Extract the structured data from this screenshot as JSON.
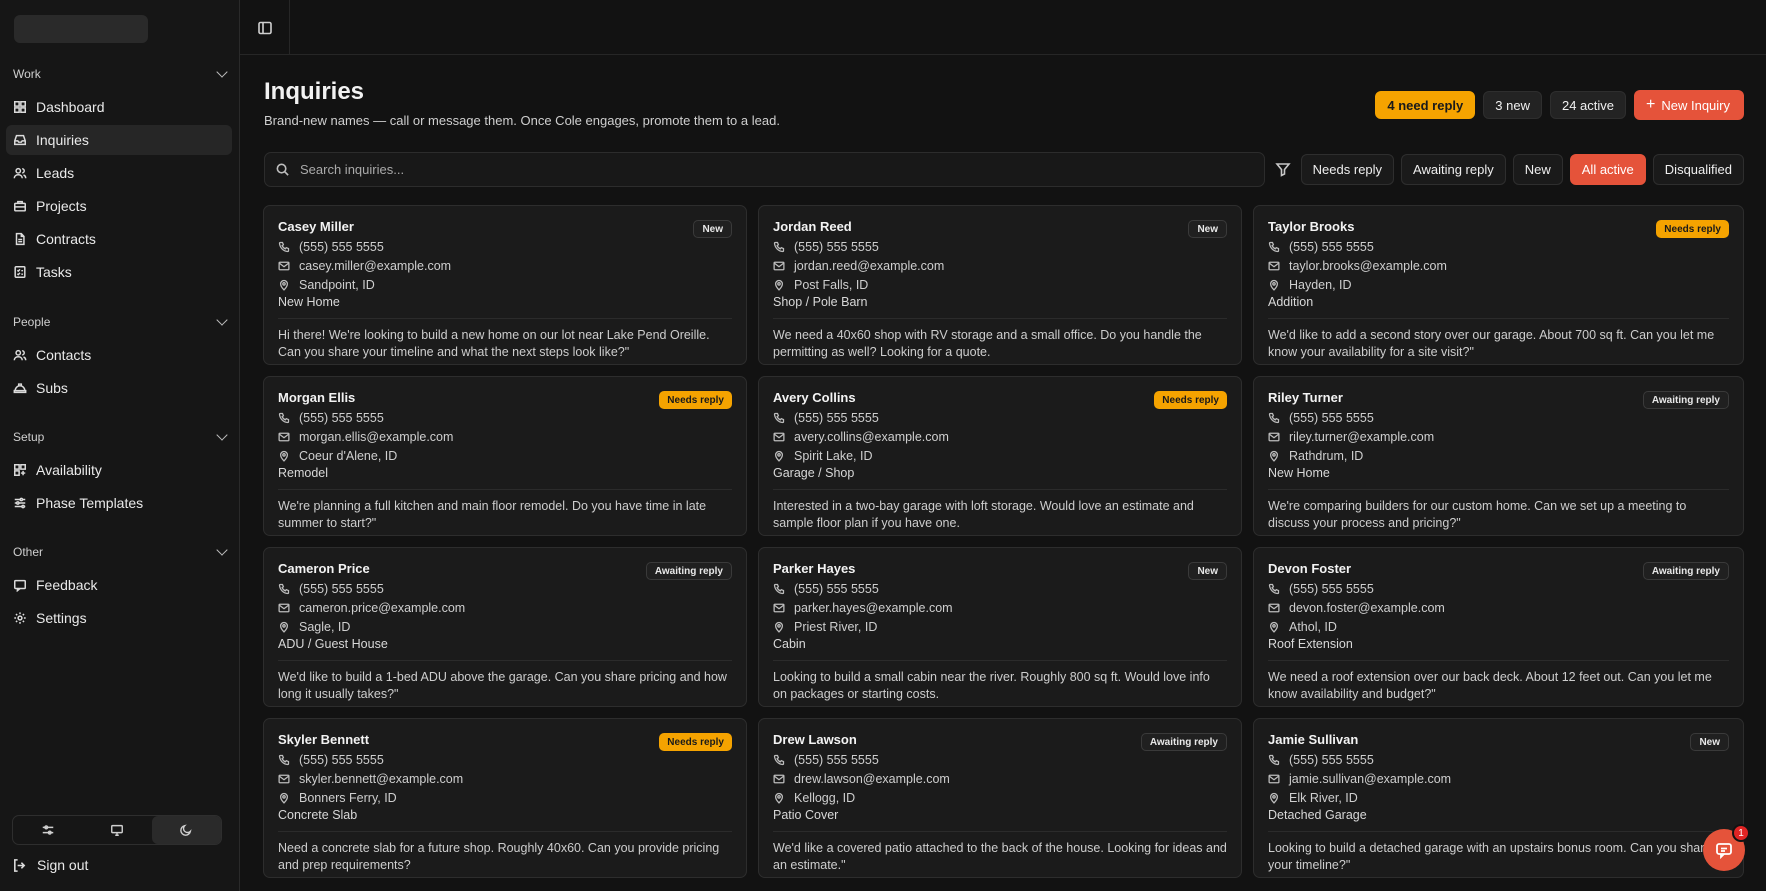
{
  "sidebar": {
    "groups": [
      {
        "label": "Work",
        "items": [
          {
            "label": "Dashboard",
            "icon": "dashboard-icon"
          },
          {
            "label": "Inquiries",
            "icon": "inbox-icon",
            "active": true
          },
          {
            "label": "Leads",
            "icon": "users-icon"
          },
          {
            "label": "Projects",
            "icon": "briefcase-icon"
          },
          {
            "label": "Contracts",
            "icon": "file-icon"
          },
          {
            "label": "Tasks",
            "icon": "checklist-icon"
          }
        ]
      },
      {
        "label": "People",
        "items": [
          {
            "label": "Contacts",
            "icon": "users-icon"
          },
          {
            "label": "Subs",
            "icon": "hardhat-icon"
          }
        ]
      },
      {
        "label": "Setup",
        "items": [
          {
            "label": "Availability",
            "icon": "calendar-icon"
          },
          {
            "label": "Phase Templates",
            "icon": "layers-icon"
          }
        ]
      },
      {
        "label": "Other",
        "items": [
          {
            "label": "Feedback",
            "icon": "message-icon"
          },
          {
            "label": "Settings",
            "icon": "gear-icon"
          }
        ]
      }
    ],
    "sign_out": "Sign out"
  },
  "header": {
    "title": "Inquiries",
    "subtitle": "Brand-new names — call or message them. Once Cole engages, promote them to a lead.",
    "stats": {
      "need_reply": "4 need reply",
      "new": "3 new",
      "active": "24 active"
    },
    "new_button": "New Inquiry"
  },
  "search": {
    "placeholder": "Search inquiries..."
  },
  "filters": [
    {
      "label": "Needs reply",
      "active": false
    },
    {
      "label": "Awaiting reply",
      "active": false
    },
    {
      "label": "New",
      "active": false
    },
    {
      "label": "All active",
      "active": true
    },
    {
      "label": "Disqualified",
      "active": false
    }
  ],
  "inquiries": [
    {
      "name": "Casey Miller",
      "status": "New",
      "status_type": "new",
      "phone": "(555) 555 5555",
      "email": "casey.miller@example.com",
      "location": "Sandpoint, ID",
      "project": "New Home",
      "message": "Hi there! We're looking to build a new home on our lot near Lake Pend Oreille. Can you share your timeline and what the next steps look like?\""
    },
    {
      "name": "Jordan Reed",
      "status": "New",
      "status_type": "new",
      "phone": "(555) 555 5555",
      "email": "jordan.reed@example.com",
      "location": "Post Falls, ID",
      "project": "Shop / Pole Barn",
      "message": "We need a 40x60 shop with RV storage and a small office. Do you handle the permitting as well? Looking for a quote."
    },
    {
      "name": "Taylor Brooks",
      "status": "Needs reply",
      "status_type": "needs",
      "phone": "(555) 555 5555",
      "email": "taylor.brooks@example.com",
      "location": "Hayden, ID",
      "project": "Addition",
      "message": "We'd like to add a second story over our garage. About 700 sq ft. Can you let me know your availability for a site visit?\""
    },
    {
      "name": "Morgan Ellis",
      "status": "Needs reply",
      "status_type": "needs",
      "phone": "(555) 555 5555",
      "email": "morgan.ellis@example.com",
      "location": "Coeur d'Alene, ID",
      "project": "Remodel",
      "message": "We're planning a full kitchen and main floor remodel. Do you have time in late summer to start?\""
    },
    {
      "name": "Avery Collins",
      "status": "Needs reply",
      "status_type": "needs",
      "phone": "(555) 555 5555",
      "email": "avery.collins@example.com",
      "location": "Spirit Lake, ID",
      "project": "Garage / Shop",
      "message": "Interested in a two-bay garage with loft storage. Would love an estimate and sample floor plan if you have one."
    },
    {
      "name": "Riley Turner",
      "status": "Awaiting reply",
      "status_type": "awaiting",
      "phone": "(555) 555 5555",
      "email": "riley.turner@example.com",
      "location": "Rathdrum, ID",
      "project": "New Home",
      "message": "We're comparing builders for our custom home. Can we set up a meeting to discuss your process and pricing?\""
    },
    {
      "name": "Cameron Price",
      "status": "Awaiting reply",
      "status_type": "awaiting",
      "phone": "(555) 555 5555",
      "email": "cameron.price@example.com",
      "location": "Sagle, ID",
      "project": "ADU / Guest House",
      "message": "We'd like to build a 1-bed ADU above the garage. Can you share pricing and how long it usually takes?\""
    },
    {
      "name": "Parker Hayes",
      "status": "New",
      "status_type": "new",
      "phone": "(555) 555 5555",
      "email": "parker.hayes@example.com",
      "location": "Priest River, ID",
      "project": "Cabin",
      "message": "Looking to build a small cabin near the river. Roughly 800 sq ft. Would love info on packages or starting costs."
    },
    {
      "name": "Devon Foster",
      "status": "Awaiting reply",
      "status_type": "awaiting",
      "phone": "(555) 555 5555",
      "email": "devon.foster@example.com",
      "location": "Athol, ID",
      "project": "Roof Extension",
      "message": "We need a roof extension over our back deck. About 12 feet out. Can you let me know availability and budget?\""
    },
    {
      "name": "Skyler Bennett",
      "status": "Needs reply",
      "status_type": "needs",
      "phone": "(555) 555 5555",
      "email": "skyler.bennett@example.com",
      "location": "Bonners Ferry, ID",
      "project": "Concrete Slab",
      "message": "Need a concrete slab for a future shop. Roughly 40x60. Can you provide pricing and prep requirements?"
    },
    {
      "name": "Drew Lawson",
      "status": "Awaiting reply",
      "status_type": "awaiting",
      "phone": "(555) 555 5555",
      "email": "drew.lawson@example.com",
      "location": "Kellogg, ID",
      "project": "Patio Cover",
      "message": "We'd like a covered patio attached to the back of the house. Looking for ideas and an estimate.\""
    },
    {
      "name": "Jamie Sullivan",
      "status": "New",
      "status_type": "new",
      "phone": "(555) 555 5555",
      "email": "jamie.sullivan@example.com",
      "location": "Elk River, ID",
      "project": "Detached Garage",
      "message": "Looking to build a detached garage with an upstairs bonus room. Can you share your timeline?\""
    }
  ],
  "chat": {
    "count": "1"
  }
}
